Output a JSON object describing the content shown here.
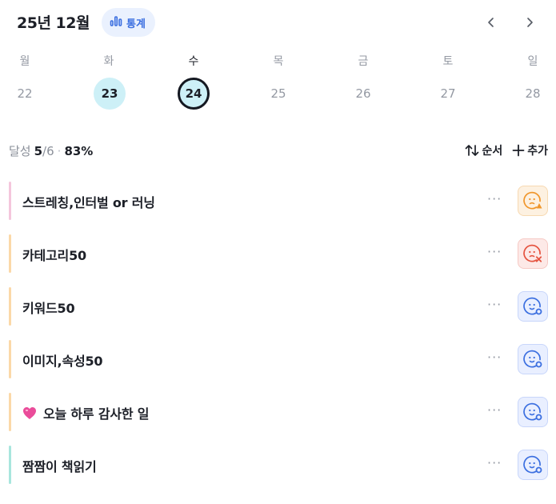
{
  "header": {
    "month_title": "25년 12월",
    "stats_label": "통계",
    "prev_icon": "chevron-left-icon",
    "next_icon": "chevron-right-icon"
  },
  "week": {
    "days": [
      {
        "weekday": "월",
        "date": "22",
        "state": "normal"
      },
      {
        "weekday": "화",
        "date": "23",
        "state": "done"
      },
      {
        "weekday": "수",
        "date": "24",
        "state": "today"
      },
      {
        "weekday": "목",
        "date": "25",
        "state": "normal"
      },
      {
        "weekday": "금",
        "date": "26",
        "state": "normal"
      },
      {
        "weekday": "토",
        "date": "27",
        "state": "normal"
      },
      {
        "weekday": "일",
        "date": "28",
        "state": "normal"
      }
    ]
  },
  "summary": {
    "label": "달성",
    "done": "5",
    "total": "/6",
    "separator": "·",
    "percent": "83%"
  },
  "toolbar": {
    "order_label": "순서",
    "add_label": "추가"
  },
  "tasks": [
    {
      "title": "스트레칭,인터벌 or 러닝",
      "color": "#f4c6dc",
      "status": "warn",
      "emoji": ""
    },
    {
      "title": "카테고리50",
      "color": "#fbd8a8",
      "status": "fail",
      "emoji": ""
    },
    {
      "title": "키워드50",
      "color": "#fbd8a8",
      "status": "ok",
      "emoji": ""
    },
    {
      "title": "이미지,속성50",
      "color": "#fbd8a8",
      "status": "ok",
      "emoji": ""
    },
    {
      "title": "오늘 하루 감사한 일",
      "color": "#fbd8a8",
      "status": "ok",
      "emoji": "heart-icon"
    },
    {
      "title": "짬짬이 책읽기",
      "color": "#a8e6dd",
      "status": "ok",
      "emoji": ""
    }
  ],
  "more_label": "···",
  "colors": {
    "accent": "#3b6fe0",
    "today_ring": "#141821",
    "done_fill": "#cdf0f7",
    "warn": "#f0962b",
    "fail": "#e5533f",
    "ok": "#3b6fe0"
  }
}
